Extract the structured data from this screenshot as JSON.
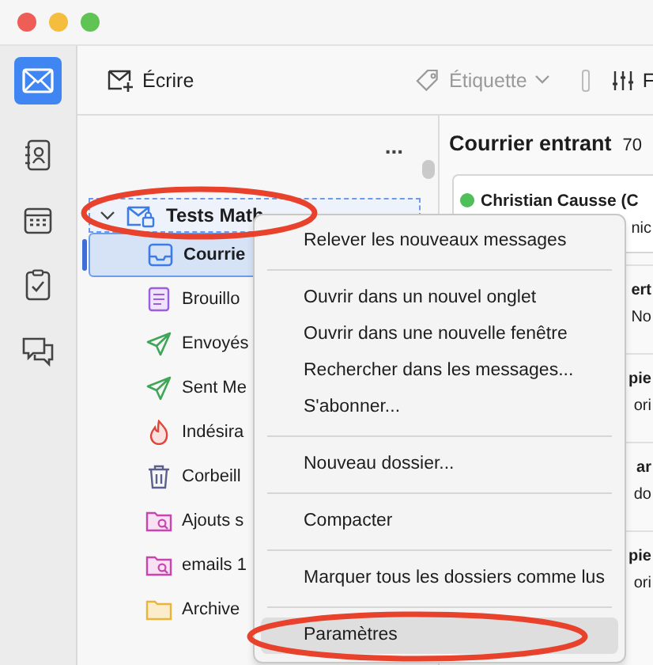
{
  "toolbar": {
    "compose": "Écrire",
    "tag": {
      "label": "Étiquette",
      "disabled": true
    },
    "filter": "F"
  },
  "folder_pane": {
    "more": "...",
    "account": {
      "name": "Tests Math",
      "expanded": true,
      "circled": true
    },
    "folders": [
      {
        "kind": "inbox",
        "name": "Courrie",
        "selected": true
      },
      {
        "kind": "drafts",
        "name": "Brouillo",
        "selected": false
      },
      {
        "kind": "sent",
        "name": "Envoyés",
        "selected": false
      },
      {
        "kind": "sent",
        "name": "Sent Me",
        "selected": false
      },
      {
        "kind": "junk",
        "name": "Indésira",
        "selected": false
      },
      {
        "kind": "trash",
        "name": "Corbeill",
        "selected": false
      },
      {
        "kind": "search",
        "name": "Ajouts s",
        "selected": false
      },
      {
        "kind": "search",
        "name": "emails 1",
        "selected": false
      },
      {
        "kind": "folder",
        "name": "Archive",
        "selected": false
      }
    ]
  },
  "message_pane": {
    "title": "Courrier entrant",
    "count": "70",
    "messages": [
      {
        "sender": "Christian Causse (C",
        "line_2": "nic"
      },
      {
        "line_1": "ert",
        "line_2": "No"
      },
      {
        "line_1": "pie",
        "line_2": "ori"
      },
      {
        "line_1": "ar",
        "line_2": "do"
      },
      {
        "line_1": "pie",
        "line_2": "ori"
      }
    ]
  },
  "context_menu": [
    {
      "kind": "item",
      "label": "Relever les nouveaux messages",
      "selected": false,
      "circled": false
    },
    {
      "kind": "separator"
    },
    {
      "kind": "item",
      "label": "Ouvrir dans un nouvel onglet",
      "selected": false,
      "circled": false
    },
    {
      "kind": "item",
      "label": "Ouvrir dans une nouvelle fenêtre",
      "selected": false,
      "circled": false
    },
    {
      "kind": "item",
      "label": "Rechercher dans les messages...",
      "selected": false,
      "circled": false
    },
    {
      "kind": "item",
      "label": "S'abonner...",
      "selected": false,
      "circled": false
    },
    {
      "kind": "separator"
    },
    {
      "kind": "item",
      "label": "Nouveau dossier...",
      "selected": false,
      "circled": false
    },
    {
      "kind": "separator"
    },
    {
      "kind": "item",
      "label": "Compacter",
      "selected": false,
      "circled": false
    },
    {
      "kind": "separator"
    },
    {
      "kind": "item",
      "label": "Marquer tous les dossiers comme lus",
      "selected": false,
      "circled": false
    },
    {
      "kind": "separator"
    },
    {
      "kind": "item",
      "label": "Paramètres",
      "selected": true,
      "circled": true
    }
  ]
}
